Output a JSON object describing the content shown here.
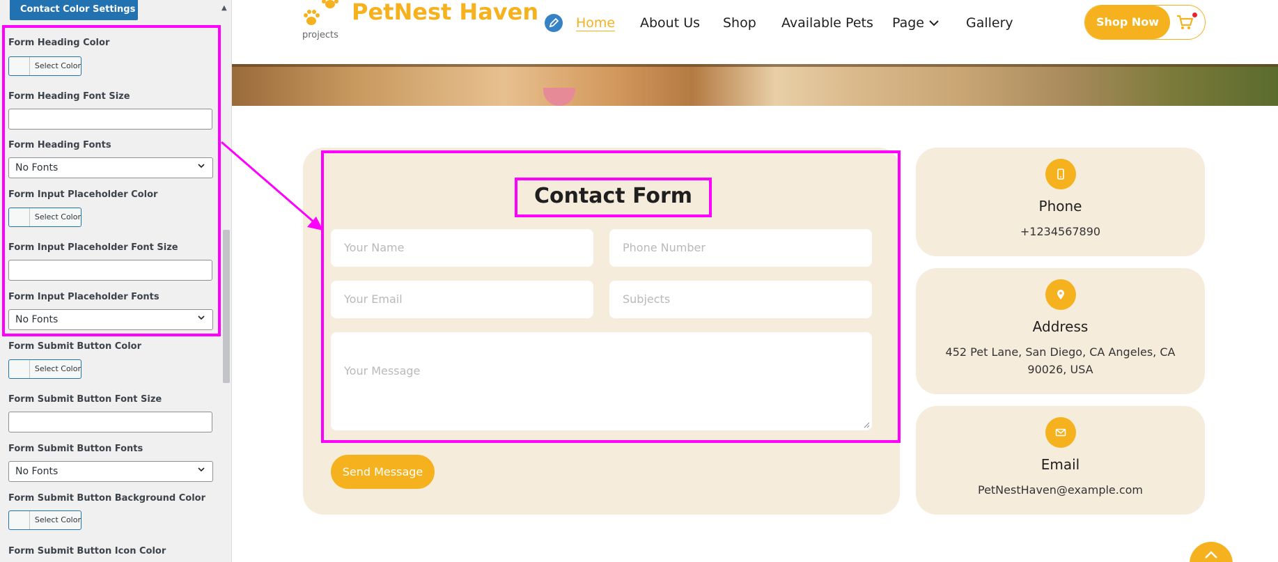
{
  "sidebar": {
    "section_title": "Contact Color Settings",
    "select_color_label": "Select Color",
    "no_fonts_label": "No Fonts",
    "controls": {
      "heading_color": "Form Heading Color",
      "heading_font_size": "Form Heading Font Size",
      "heading_fonts": "Form Heading Fonts",
      "placeholder_color": "Form Input Placeholder Color",
      "placeholder_font_size": "Form Input Placeholder Font Size",
      "placeholder_fonts": "Form Input Placeholder Fonts",
      "submit_color": "Form Submit Button Color",
      "submit_font_size": "Form Submit Button Font Size",
      "submit_fonts": "Form Submit Button Fonts",
      "submit_bg_color": "Form Submit Button Background Color",
      "submit_icon_color": "Form Submit Button Icon Color"
    }
  },
  "site": {
    "logo_title": "PetNest Haven",
    "logo_subtitle": "projects",
    "nav": [
      "Home",
      "About Us",
      "Shop",
      "Available Pets",
      "Page",
      "Gallery"
    ],
    "shop_now": "Shop Now"
  },
  "contact_form": {
    "title": "Contact Form",
    "placeholders": {
      "name": "Your Name",
      "phone": "Phone Number",
      "email": "Your Email",
      "subject": "Subjects",
      "message": "Your Message"
    },
    "submit": "Send Message"
  },
  "info_cards": [
    {
      "title": "Phone",
      "text": "+1234567890",
      "icon": "phone-icon"
    },
    {
      "title": "Address",
      "text": "452 Pet Lane, San Diego, CA Angeles, CA 90026, USA",
      "icon": "location-pin-icon"
    },
    {
      "title": "Email",
      "text": "PetNestHaven@example.com",
      "icon": "envelope-icon"
    }
  ],
  "colors": {
    "accent": "#f5b21e",
    "highlight": "#ff00ff",
    "panel_bg": "#f5ecdc",
    "wp_blue": "#2271b1"
  }
}
